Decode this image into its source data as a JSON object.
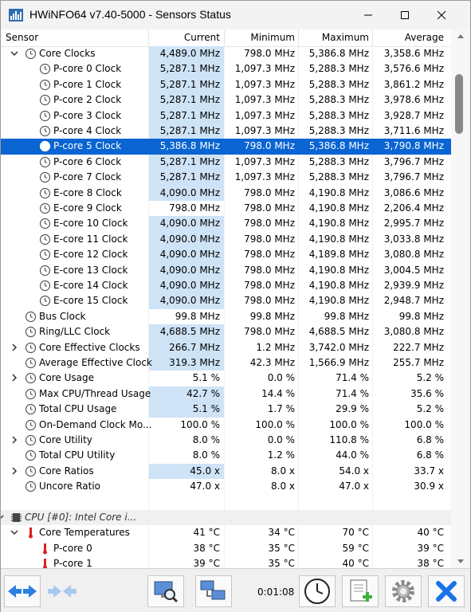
{
  "window": {
    "title": "HWiNFO64 v7.40-5000 - Sensors Status"
  },
  "columns": {
    "sensor": "Sensor",
    "current": "Current",
    "minimum": "Minimum",
    "maximum": "Maximum",
    "average": "Average"
  },
  "rows": [
    {
      "label": "Core Clocks",
      "cur": "4,489.0 MHz",
      "min": "798.0 MHz",
      "max": "5,386.8 MHz",
      "avg": "3,358.6 MHz"
    },
    {
      "label": "P-core 0 Clock",
      "cur": "5,287.1 MHz",
      "min": "1,097.3 MHz",
      "max": "5,288.3 MHz",
      "avg": "3,576.6 MHz"
    },
    {
      "label": "P-core 1 Clock",
      "cur": "5,287.1 MHz",
      "min": "1,097.3 MHz",
      "max": "5,288.3 MHz",
      "avg": "3,861.2 MHz"
    },
    {
      "label": "P-core 2 Clock",
      "cur": "5,287.1 MHz",
      "min": "1,097.3 MHz",
      "max": "5,288.3 MHz",
      "avg": "3,978.6 MHz"
    },
    {
      "label": "P-core 3 Clock",
      "cur": "5,287.1 MHz",
      "min": "1,097.3 MHz",
      "max": "5,288.3 MHz",
      "avg": "3,928.7 MHz"
    },
    {
      "label": "P-core 4 Clock",
      "cur": "5,287.1 MHz",
      "min": "1,097.3 MHz",
      "max": "5,288.3 MHz",
      "avg": "3,711.6 MHz"
    },
    {
      "label": "P-core 5 Clock",
      "cur": "5,386.8 MHz",
      "min": "798.0 MHz",
      "max": "5,386.8 MHz",
      "avg": "3,790.8 MHz"
    },
    {
      "label": "P-core 6 Clock",
      "cur": "5,287.1 MHz",
      "min": "1,097.3 MHz",
      "max": "5,288.3 MHz",
      "avg": "3,796.7 MHz"
    },
    {
      "label": "P-core 7 Clock",
      "cur": "5,287.1 MHz",
      "min": "1,097.3 MHz",
      "max": "5,288.3 MHz",
      "avg": "3,796.7 MHz"
    },
    {
      "label": "E-core 8 Clock",
      "cur": "4,090.0 MHz",
      "min": "798.0 MHz",
      "max": "4,190.8 MHz",
      "avg": "3,086.6 MHz"
    },
    {
      "label": "E-core 9 Clock",
      "cur": "798.0 MHz",
      "min": "798.0 MHz",
      "max": "4,190.8 MHz",
      "avg": "2,206.4 MHz"
    },
    {
      "label": "E-core 10 Clock",
      "cur": "4,090.0 MHz",
      "min": "798.0 MHz",
      "max": "4,190.8 MHz",
      "avg": "2,995.7 MHz"
    },
    {
      "label": "E-core 11 Clock",
      "cur": "4,090.0 MHz",
      "min": "798.0 MHz",
      "max": "4,190.8 MHz",
      "avg": "3,033.8 MHz"
    },
    {
      "label": "E-core 12 Clock",
      "cur": "4,090.0 MHz",
      "min": "798.0 MHz",
      "max": "4,189.8 MHz",
      "avg": "3,080.8 MHz"
    },
    {
      "label": "E-core 13 Clock",
      "cur": "4,090.0 MHz",
      "min": "798.0 MHz",
      "max": "4,190.8 MHz",
      "avg": "3,004.5 MHz"
    },
    {
      "label": "E-core 14 Clock",
      "cur": "4,090.0 MHz",
      "min": "798.0 MHz",
      "max": "4,190.8 MHz",
      "avg": "2,939.9 MHz"
    },
    {
      "label": "E-core 15 Clock",
      "cur": "4,090.0 MHz",
      "min": "798.0 MHz",
      "max": "4,190.8 MHz",
      "avg": "2,948.7 MHz"
    },
    {
      "label": "Bus Clock",
      "cur": "99.8 MHz",
      "min": "99.8 MHz",
      "max": "99.8 MHz",
      "avg": "99.8 MHz"
    },
    {
      "label": "Ring/LLC Clock",
      "cur": "4,688.5 MHz",
      "min": "798.0 MHz",
      "max": "4,688.5 MHz",
      "avg": "3,080.8 MHz"
    },
    {
      "label": "Core Effective Clocks",
      "cur": "266.7 MHz",
      "min": "1.2 MHz",
      "max": "3,742.0 MHz",
      "avg": "222.7 MHz"
    },
    {
      "label": "Average Effective Clock",
      "cur": "319.3 MHz",
      "min": "42.3 MHz",
      "max": "1,566.9 MHz",
      "avg": "255.7 MHz"
    },
    {
      "label": "Core Usage",
      "cur": "5.1 %",
      "min": "0.0 %",
      "max": "71.4 %",
      "avg": "5.2 %"
    },
    {
      "label": "Max CPU/Thread Usage",
      "cur": "42.7 %",
      "min": "14.4 %",
      "max": "71.4 %",
      "avg": "35.6 %"
    },
    {
      "label": "Total CPU Usage",
      "cur": "5.1 %",
      "min": "1.7 %",
      "max": "29.9 %",
      "avg": "5.2 %"
    },
    {
      "label": "On-Demand Clock Mo...",
      "cur": "100.0 %",
      "min": "100.0 %",
      "max": "100.0 %",
      "avg": "100.0 %"
    },
    {
      "label": "Core Utility",
      "cur": "8.0 %",
      "min": "0.0 %",
      "max": "110.8 %",
      "avg": "6.8 %"
    },
    {
      "label": "Total CPU Utility",
      "cur": "8.0 %",
      "min": "1.2 %",
      "max": "44.0 %",
      "avg": "6.8 %"
    },
    {
      "label": "Core Ratios",
      "cur": "45.0 x",
      "min": "8.0 x",
      "max": "54.0 x",
      "avg": "33.7 x"
    },
    {
      "label": "Uncore Ratio",
      "cur": "47.0 x",
      "min": "8.0 x",
      "max": "47.0 x",
      "avg": "30.9 x"
    },
    {
      "label": "",
      "cur": "",
      "min": "",
      "max": "",
      "avg": ""
    },
    {
      "label": "CPU [#0]: Intel Core i...",
      "cur": "",
      "min": "",
      "max": "",
      "avg": ""
    },
    {
      "label": "Core Temperatures",
      "cur": "41 °C",
      "min": "34 °C",
      "max": "70 °C",
      "avg": "40 °C"
    },
    {
      "label": "P-core 0",
      "cur": "38 °C",
      "min": "35 °C",
      "max": "59 °C",
      "avg": "39 °C"
    },
    {
      "label": "P-core 1",
      "cur": "39 °C",
      "min": "35 °C",
      "max": "40 °C",
      "avg": "38 °C"
    }
  ],
  "toolbar": {
    "timer": "0:01:08"
  },
  "colors": {
    "selection": "#0a64d2",
    "value_highlight": "#cfe3f7",
    "accent_close": "#1a73e8"
  }
}
